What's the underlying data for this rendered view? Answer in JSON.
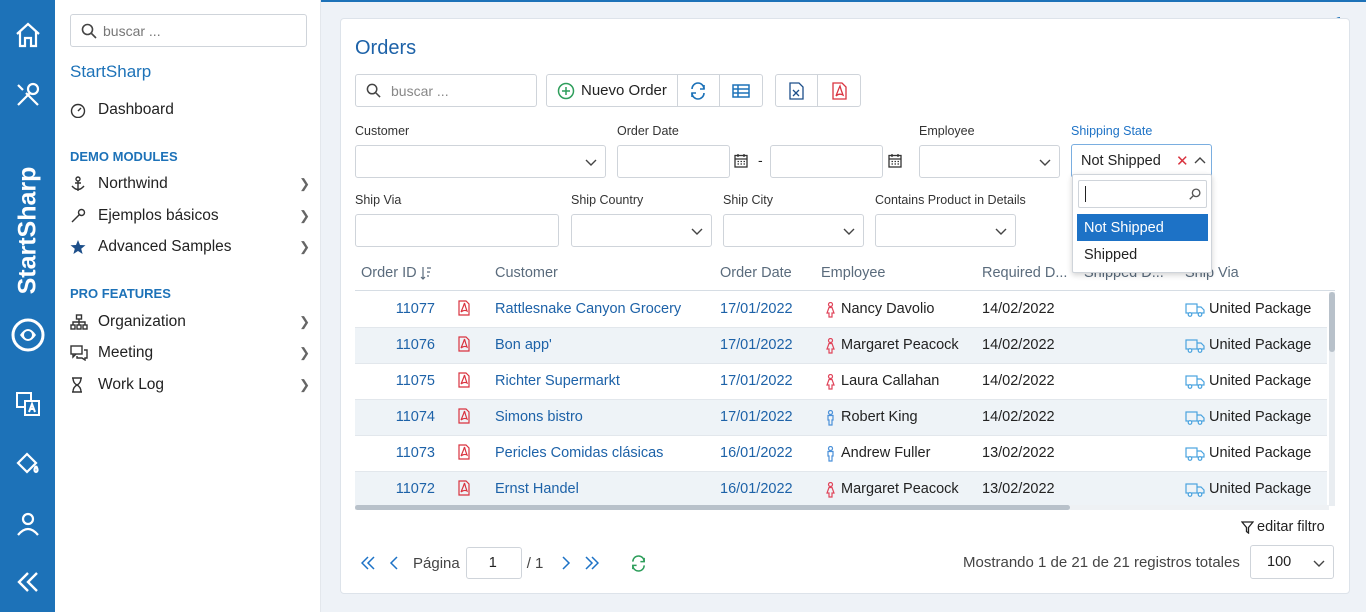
{
  "sidebar": {
    "search_placeholder": "buscar ...",
    "app_name": "StartSharp",
    "brand_vertical": "StartSharp",
    "dashboard": "Dashboard",
    "demo_header": "DEMO MODULES",
    "demo_items": [
      "Northwind",
      "Ejemplos básicos",
      "Advanced Samples"
    ],
    "pro_header": "PRO FEATURES",
    "pro_items": [
      "Organization",
      "Meeting",
      "Work Log"
    ]
  },
  "page": {
    "title": "Orders",
    "search_placeholder": "buscar ...",
    "new_button": "Nuevo Order"
  },
  "filters": {
    "customer": "Customer",
    "order_date": "Order Date",
    "date_sep": "-",
    "employee": "Employee",
    "shipping_state": "Shipping State",
    "shipping_state_value": "Not Shipped",
    "ship_via": "Ship Via",
    "ship_country": "Ship Country",
    "ship_city": "Ship City",
    "contains_product": "Contains Product in Details"
  },
  "dropdown": {
    "options": [
      "Not Shipped",
      "Shipped"
    ],
    "selected": "Not Shipped"
  },
  "grid": {
    "columns": [
      "Order ID",
      "Customer",
      "Order Date",
      "Employee",
      "Required D...",
      "Shipped D...",
      "Ship Via"
    ],
    "rows": [
      {
        "id": "11077",
        "customer": "Rattlesnake Canyon Grocery",
        "date": "17/01/2022",
        "employee": "Nancy Davolio",
        "gender": "female",
        "required": "14/02/2022",
        "shipped": "",
        "via": "United Package"
      },
      {
        "id": "11076",
        "customer": "Bon app'",
        "date": "17/01/2022",
        "employee": "Margaret Peacock",
        "gender": "female",
        "required": "14/02/2022",
        "shipped": "",
        "via": "United Package"
      },
      {
        "id": "11075",
        "customer": "Richter Supermarkt",
        "date": "17/01/2022",
        "employee": "Laura Callahan",
        "gender": "female",
        "required": "14/02/2022",
        "shipped": "",
        "via": "United Package"
      },
      {
        "id": "11074",
        "customer": "Simons bistro",
        "date": "17/01/2022",
        "employee": "Robert King",
        "gender": "male",
        "required": "14/02/2022",
        "shipped": "",
        "via": "United Package"
      },
      {
        "id": "11073",
        "customer": "Pericles Comidas clásicas",
        "date": "16/01/2022",
        "employee": "Andrew Fuller",
        "gender": "male",
        "required": "13/02/2022",
        "shipped": "",
        "via": "United Package"
      },
      {
        "id": "11072",
        "customer": "Ernst Handel",
        "date": "16/01/2022",
        "employee": "Margaret Peacock",
        "gender": "female",
        "required": "13/02/2022",
        "shipped": "",
        "via": "United Package"
      }
    ]
  },
  "footer": {
    "edit_filter": "editar filtro",
    "page_label": "Página",
    "page_value": "1",
    "page_total": "/ 1",
    "status": "Mostrando 1 de 21 de 21 registros totales",
    "page_size": "100"
  },
  "colors": {
    "brand": "#1d72b8",
    "link": "#1d62a8",
    "pdf": "#d9333f",
    "female": "#e0445a",
    "male": "#4a90d9",
    "truck": "#4aa3df",
    "refresh": "#2e9e5b"
  }
}
